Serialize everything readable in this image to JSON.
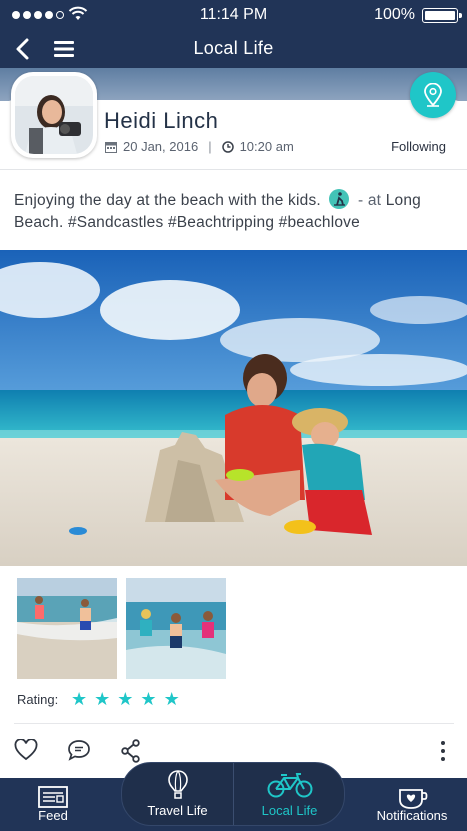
{
  "status_bar": {
    "time": "11:14 PM",
    "battery": "100%",
    "signal_bars": 4,
    "signal_total": 5
  },
  "nav": {
    "title": "Local Life",
    "back_icon": "chevron-left-icon",
    "menu_icon": "hamburger-icon"
  },
  "post": {
    "author": "Heidi Linch",
    "date": "20 Jan, 2016",
    "time": "10:20 am",
    "follow_status": "Following",
    "caption_text": "Enjoying the day at the beach with the kids.",
    "caption_at": "-  at",
    "caption_place": "Long Beach.",
    "hashtags": "#Sandcastles #Beachtripping #beachlove",
    "rating_label": "Rating:",
    "rating": 5,
    "rating_max": 5
  },
  "actions": {
    "like_icon": "heart-icon",
    "comment_icon": "comment-icon",
    "share_icon": "share-icon",
    "more_icon": "more-vertical-icon"
  },
  "tabs": {
    "feed": "Feed",
    "travel_life": "Travel Life",
    "local_life": "Local Life",
    "notifications": "Notifications"
  },
  "colors": {
    "navy": "#213457",
    "accent": "#1fc6c8",
    "text": "#3b414b"
  }
}
